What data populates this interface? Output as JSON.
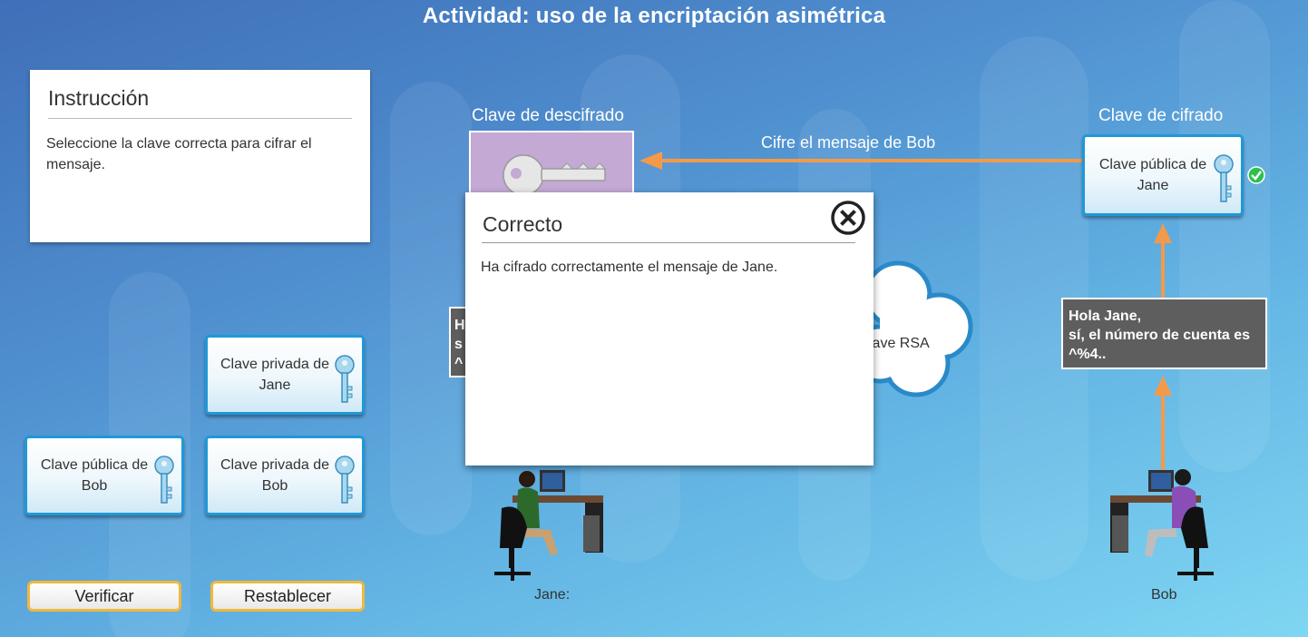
{
  "page": {
    "title": "Actividad: uso de la encriptación asimétrica"
  },
  "instruction": {
    "heading": "Instrucción",
    "text": "Seleccione la clave correcta para cifrar el mensaje."
  },
  "key_options": [
    {
      "label": "Clave privada de Jane",
      "icon": "key-icon"
    },
    {
      "label": "Clave pública de Bob",
      "icon": "key-icon"
    },
    {
      "label": "Clave privada de Bob",
      "icon": "key-icon"
    }
  ],
  "buttons": {
    "verify": "Verificar",
    "reset": "Restablecer"
  },
  "diagram": {
    "decryption_key_label": "Clave de descifrado",
    "encryption_key_label": "Clave de cifrado",
    "arrow_label": "Cifre el mensaje de Bob",
    "placed_key": "Clave pública de Jane",
    "placed_key_status": "correct-check-icon",
    "left_message_partial": [
      "H",
      "s",
      "^"
    ],
    "bob_message": [
      "Hola Jane,",
      "sí, el número de cuenta es",
      "^%4.."
    ],
    "cloud_label": "lave RSA",
    "person_left": "Jane:",
    "person_right": "Bob"
  },
  "modal": {
    "title": "Correcto",
    "text": "Ha cifrado correctamente el mensaje de Jane.",
    "close_icon": "close-circle-icon"
  },
  "colors": {
    "arrow": "#f39a4a",
    "card_border": "#1f98d8",
    "button_border": "#f0b93b",
    "decrypt_slot": "#c3a9d4",
    "message_bg": "#5e5e5e",
    "check": "#2fbf4d"
  }
}
